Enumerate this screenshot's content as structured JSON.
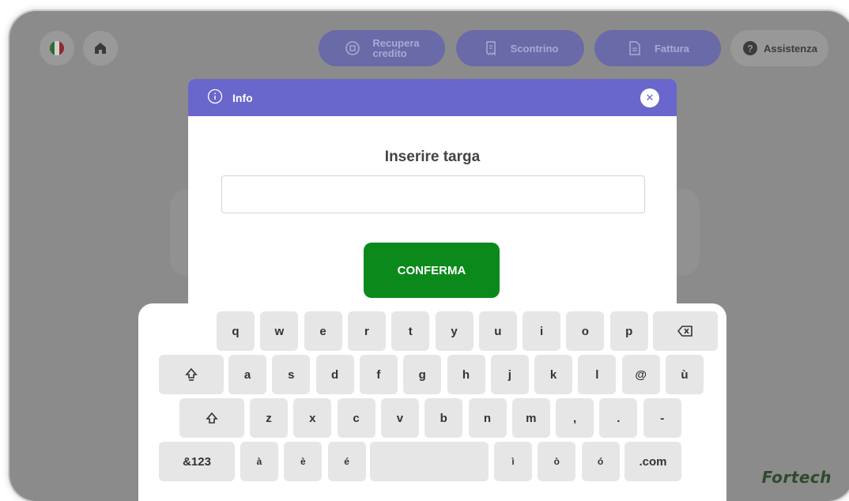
{
  "topbar": {
    "language_flag": "italian-flag",
    "home_icon": "home-icon",
    "recover_credit": {
      "line1": "Recupera",
      "line2": "credito",
      "icon": "coin-refresh-icon"
    },
    "receipt": {
      "label": "Scontrino",
      "icon": "receipt-icon"
    },
    "invoice": {
      "label": "Fattura",
      "icon": "document-icon"
    },
    "assistance": {
      "label": "Assistenza",
      "icon": "help-icon"
    }
  },
  "modal": {
    "header_title": "Info",
    "header_icon": "info-icon",
    "close_icon": "close-icon",
    "title": "Inserire targa",
    "input_value": "",
    "confirm_label": "CONFERMA"
  },
  "keyboard": {
    "row1": [
      "q",
      "w",
      "e",
      "r",
      "t",
      "y",
      "u",
      "i",
      "o",
      "p"
    ],
    "backspace_icon": "backspace-icon",
    "caps_icon": "caps-lock-icon",
    "row2": [
      "a",
      "s",
      "d",
      "f",
      "g",
      "h",
      "j",
      "k",
      "l",
      "@",
      "ù"
    ],
    "shift_icon": "shift-icon",
    "row3": [
      "z",
      "x",
      "c",
      "v",
      "b",
      "n",
      "m",
      ",",
      ".",
      "-"
    ],
    "numbers_label": "&123",
    "row4_left": [
      "à",
      "è",
      "é"
    ],
    "row4_right": [
      "ì",
      "ò",
      "ó"
    ],
    "com_label": ".com"
  },
  "brand": "Fortech",
  "colors": {
    "modal_header": "#6966cc",
    "confirm": "#0b8a1b",
    "overlay": "#8b8b8b"
  }
}
